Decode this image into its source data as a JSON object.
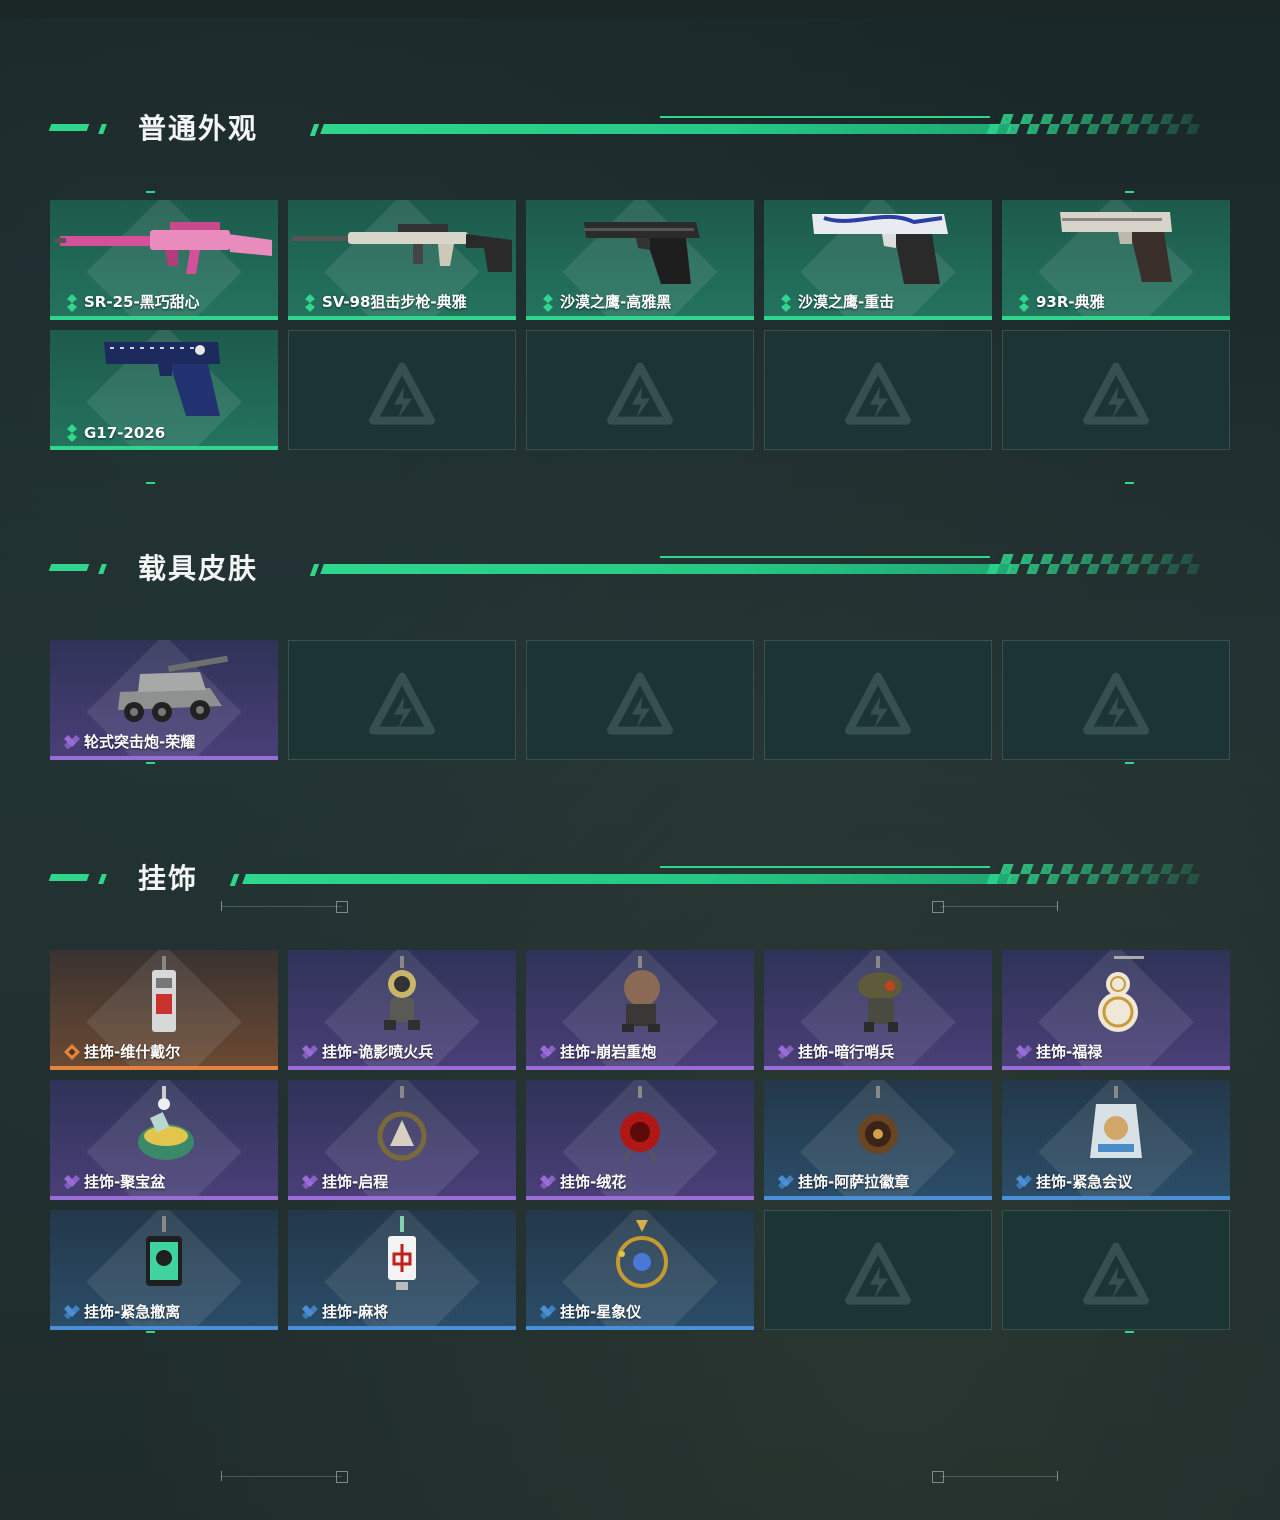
{
  "sections": [
    {
      "title": "普通外观",
      "items": [
        {
          "label": "SR-25-黑巧甜心",
          "rarity": "green",
          "icon": "rifle-pink-icon"
        },
        {
          "label": "SV-98狙击步枪-典雅",
          "rarity": "green",
          "icon": "sniper-rifle-icon"
        },
        {
          "label": "沙漠之鹰-高雅黑",
          "rarity": "green",
          "icon": "pistol-black-icon"
        },
        {
          "label": "沙漠之鹰-重击",
          "rarity": "green",
          "icon": "pistol-white-icon"
        },
        {
          "label": "93R-典雅",
          "rarity": "green",
          "icon": "pistol-silver-icon"
        },
        {
          "label": "G17-2026",
          "rarity": "green",
          "icon": "pistol-blue-icon"
        }
      ],
      "slots": 10
    },
    {
      "title": "载具皮肤",
      "items": [
        {
          "label": "轮式突击炮-荣耀",
          "rarity": "purple",
          "icon": "armored-vehicle-icon"
        }
      ],
      "slots": 5
    },
    {
      "title": "挂饰",
      "items": [
        {
          "label": "挂饰-维什戴尔",
          "rarity": "orange",
          "icon": "charm-tag-icon"
        },
        {
          "label": "挂饰-诡影喷火兵",
          "rarity": "purple",
          "icon": "charm-flamer-icon"
        },
        {
          "label": "挂饰-崩岩重炮",
          "rarity": "purple",
          "icon": "charm-gunner-icon"
        },
        {
          "label": "挂饰-暗行哨兵",
          "rarity": "purple",
          "icon": "charm-sentry-icon"
        },
        {
          "label": "挂饰-福禄",
          "rarity": "purple",
          "icon": "charm-gourd-icon"
        },
        {
          "label": "挂饰-聚宝盆",
          "rarity": "purple",
          "icon": "charm-treasure-icon"
        },
        {
          "label": "挂饰-启程",
          "rarity": "purple",
          "icon": "charm-ring-icon"
        },
        {
          "label": "挂饰-绒花",
          "rarity": "purple",
          "icon": "charm-flower-icon"
        },
        {
          "label": "挂饰-阿萨拉徽章",
          "rarity": "blue",
          "icon": "charm-badge-icon"
        },
        {
          "label": "挂饰-紧急会议",
          "rarity": "blue",
          "icon": "charm-meeting-icon"
        },
        {
          "label": "挂饰-紧急撤离",
          "rarity": "blue",
          "icon": "charm-exit-icon"
        },
        {
          "label": "挂饰-麻将",
          "rarity": "blue",
          "icon": "charm-mahjong-icon"
        },
        {
          "label": "挂饰-星象仪",
          "rarity": "blue",
          "icon": "charm-orrery-icon"
        }
      ],
      "slots": 15
    }
  ],
  "colors": {
    "accent": "#2fd68c",
    "rarity_green": "#2fd68c",
    "rarity_purple": "#9a6cd8",
    "rarity_orange": "#e5823c",
    "rarity_blue": "#4a8fd8"
  }
}
